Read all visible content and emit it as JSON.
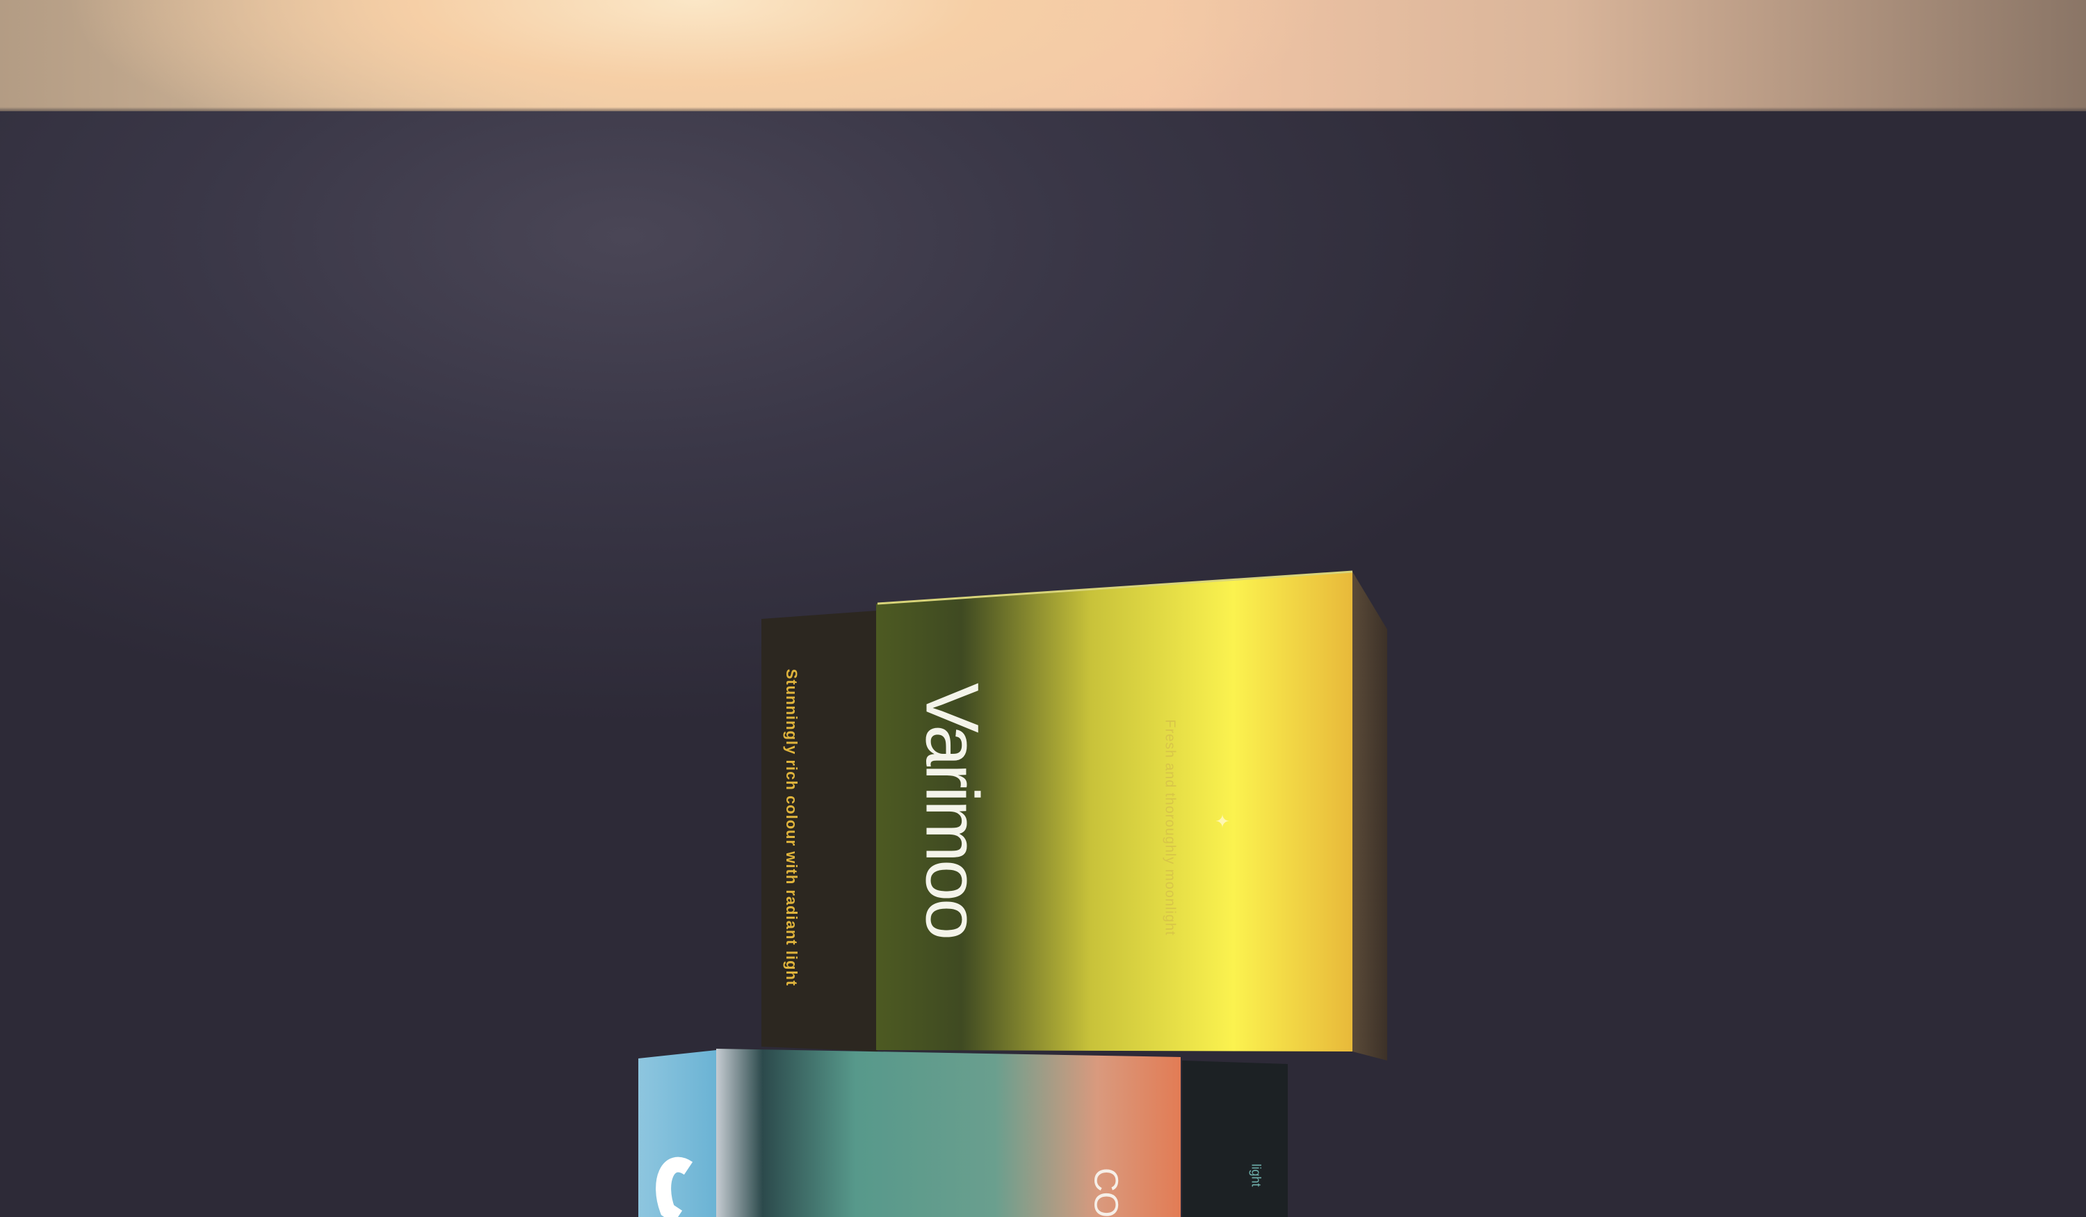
{
  "scene": {
    "description_colors": {
      "backdrop": "#36333f",
      "top_light": "#f6cfa6",
      "gold_box": "#f2e64a",
      "teal_box": "#5a9a8e",
      "coral_box": "#e08a66"
    }
  },
  "gold_box": {
    "brand": "Varimoo",
    "side_text": "Stunningly rich colour with radiant light",
    "front_text": "Fresh and thoroughly moonlight"
  },
  "teal_box": {
    "logo_text": "CO",
    "side_text": "light"
  }
}
